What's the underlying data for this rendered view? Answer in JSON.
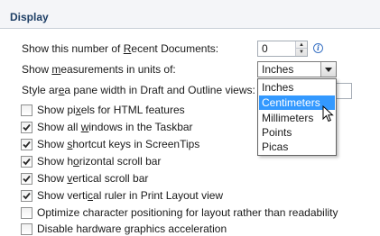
{
  "section": {
    "title": "Display"
  },
  "recent_docs": {
    "label_pre": "Show this number of ",
    "label_key": "R",
    "label_post": "ecent Documents:",
    "value": "0"
  },
  "measurements": {
    "label_pre": "Show ",
    "label_key": "m",
    "label_post": "easurements in units of:",
    "selected_value": "Inches",
    "options": [
      "Inches",
      "Centimeters",
      "Millimeters",
      "Points",
      "Picas"
    ],
    "highlighted_index": 1
  },
  "style_area": {
    "label_pre": "Style ar",
    "label_key": "e",
    "label_post": "a pane width in Draft and Outline views:"
  },
  "checkboxes": [
    {
      "pre": "Show pi",
      "key": "x",
      "post": "els for HTML features",
      "checked": false
    },
    {
      "pre": "Show all ",
      "key": "w",
      "post": "indows in the Taskbar",
      "checked": true
    },
    {
      "pre": "Show ",
      "key": "s",
      "post": "hortcut keys in ScreenTips",
      "checked": true
    },
    {
      "pre": "Show h",
      "key": "o",
      "post": "rizontal scroll bar",
      "checked": true
    },
    {
      "pre": "Show ",
      "key": "v",
      "post": "ertical scroll bar",
      "checked": true
    },
    {
      "pre": "Show verti",
      "key": "c",
      "post": "al ruler in Print Layout view",
      "checked": true
    },
    {
      "pre": "Optimize character positioning for layout rather than readability",
      "key": "",
      "post": "",
      "checked": false
    },
    {
      "pre": "Disable hardware graphics acceleration",
      "key": "",
      "post": "",
      "checked": false
    }
  ],
  "icons": {
    "info": "info-icon",
    "cursor": "mouse-pointer-icon",
    "check": "check-icon"
  }
}
